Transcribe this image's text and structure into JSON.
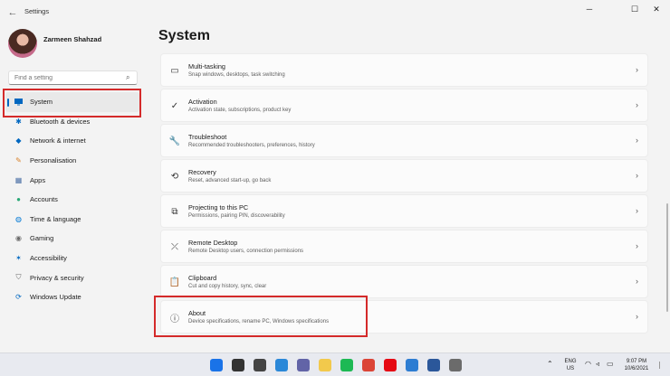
{
  "window": {
    "title": "Settings",
    "back_glyph": "←",
    "minimize_glyph": "─",
    "maximize_glyph": "☐",
    "close_glyph": "✕"
  },
  "user": {
    "name": "Zarmeen Shahzad"
  },
  "search": {
    "placeholder": "Find a setting",
    "icon": "search-icon"
  },
  "accent_color": "#0067c0",
  "highlight_color": "#d42a2a",
  "sidebar": {
    "items": [
      {
        "label": "System",
        "icon": "monitor-icon",
        "active": true
      },
      {
        "label": "Bluetooth & devices",
        "icon": "bluetooth-icon"
      },
      {
        "label": "Network & internet",
        "icon": "wifi-icon"
      },
      {
        "label": "Personalisation",
        "icon": "brush-icon"
      },
      {
        "label": "Apps",
        "icon": "apps-icon"
      },
      {
        "label": "Accounts",
        "icon": "person-icon"
      },
      {
        "label": "Time & language",
        "icon": "globe-icon"
      },
      {
        "label": "Gaming",
        "icon": "gamepad-icon"
      },
      {
        "label": "Accessibility",
        "icon": "accessibility-icon"
      },
      {
        "label": "Privacy & security",
        "icon": "shield-icon"
      },
      {
        "label": "Windows Update",
        "icon": "update-icon"
      }
    ]
  },
  "main": {
    "title": "System",
    "items": [
      {
        "title": "Multi-tasking",
        "subtitle": "Snap windows, desktops, task switching",
        "icon": "multitasking-icon",
        "glyph": "▭"
      },
      {
        "title": "Activation",
        "subtitle": "Activation state, subscriptions, product key",
        "icon": "checkmark-circle-icon",
        "glyph": "✓"
      },
      {
        "title": "Troubleshoot",
        "subtitle": "Recommended troubleshooters, preferences, history",
        "icon": "wrench-icon",
        "glyph": "🔧"
      },
      {
        "title": "Recovery",
        "subtitle": "Reset, advanced start-up, go back",
        "icon": "recovery-icon",
        "glyph": "⟲"
      },
      {
        "title": "Projecting to this PC",
        "subtitle": "Permissions, pairing PIN, discoverability",
        "icon": "projecting-icon",
        "glyph": "⧉"
      },
      {
        "title": "Remote Desktop",
        "subtitle": "Remote Desktop users, connection permissions",
        "icon": "remote-desktop-icon",
        "glyph": "⤫"
      },
      {
        "title": "Clipboard",
        "subtitle": "Cut and copy history, sync, clear",
        "icon": "clipboard-icon",
        "glyph": "📋"
      },
      {
        "title": "About",
        "subtitle": "Device specifications, rename PC, Windows specifications",
        "icon": "info-icon",
        "glyph": "ⓘ"
      }
    ],
    "chevron": "›"
  },
  "taskbar": {
    "apps": [
      {
        "name": "windows-start-icon",
        "color": "#1a73e8"
      },
      {
        "name": "taskbar-search-icon",
        "color": "#333333"
      },
      {
        "name": "task-view-icon",
        "color": "#444444"
      },
      {
        "name": "widgets-icon",
        "color": "#2b88d8"
      },
      {
        "name": "teams-chat-icon",
        "color": "#6264a7"
      },
      {
        "name": "file-explorer-icon",
        "color": "#f2c94c"
      },
      {
        "name": "spotify-icon",
        "color": "#1db954"
      },
      {
        "name": "chrome-icon",
        "color": "#db4437"
      },
      {
        "name": "netflix-icon",
        "color": "#e50914"
      },
      {
        "name": "photos-icon",
        "color": "#2d7dd2"
      },
      {
        "name": "word-icon",
        "color": "#2b579a"
      },
      {
        "name": "settings-gear-icon",
        "color": "#6b6b6b"
      }
    ],
    "tray": {
      "chevron": "⌃",
      "language": "ENG",
      "region": "US",
      "time": "9:07 PM",
      "date": "10/6/2021"
    }
  }
}
